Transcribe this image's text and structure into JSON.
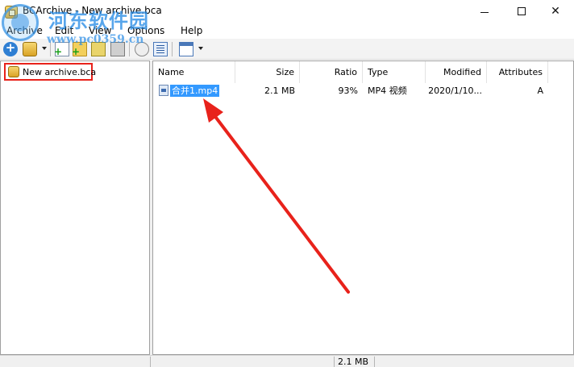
{
  "window": {
    "title": "BCArchive - New archive.bca"
  },
  "watermark": {
    "title": "河东软件园",
    "url": "www.pc0359.cn"
  },
  "menu": [
    {
      "label": "Archive"
    },
    {
      "label": "Edit"
    },
    {
      "label": "View"
    },
    {
      "label": "Options"
    },
    {
      "label": "Help"
    }
  ],
  "toolbar": {
    "icons": [
      "add-icon",
      "archive-icon",
      "new-file-icon",
      "new-folder-icon",
      "extract-icon",
      "delete-icon",
      "properties-icon",
      "details-view-icon",
      "view-options-icon"
    ]
  },
  "tree": {
    "item_label": "New archive.bca"
  },
  "list": {
    "columns": [
      "Name",
      "Size",
      "Ratio",
      "Type",
      "Modified",
      "Attributes"
    ],
    "rows": [
      {
        "name": "合并1.mp4",
        "size": "2.1 MB",
        "ratio": "93%",
        "type": "MP4 视频",
        "modified": "2020/1/10...",
        "attributes": "A"
      }
    ]
  },
  "status": {
    "total_size": "2.1 MB"
  },
  "colors": {
    "highlight_border": "#e8221b",
    "selection": "#3399ff",
    "arrow": "#e8221b"
  }
}
